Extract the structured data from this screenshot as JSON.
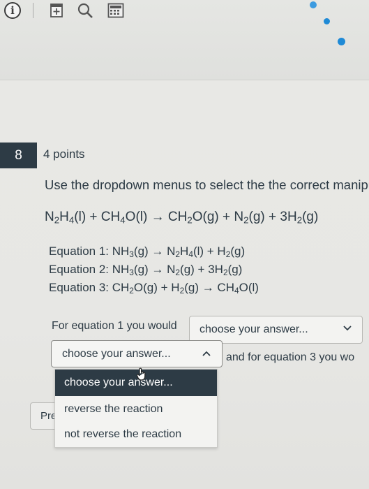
{
  "toolbar": {
    "icons": [
      "info-icon",
      "document-icon",
      "search-icon",
      "calculator-icon"
    ],
    "info_glyph": "i"
  },
  "question": {
    "number": "8",
    "points": "4 points",
    "instruction": "Use the dropdown menus to select the the correct manipu",
    "main_equation": {
      "a": "N",
      "a_sub1": "2",
      "b": "H",
      "b_sub": "4",
      "c": "(l) + CH",
      "c_sub": "4",
      "d": "O(l) → CH",
      "d_sub": "2",
      "e": "O(g) + N",
      "e_sub": "2",
      "f": "(g) + 3H",
      "f_sub": "2",
      "g": "(g)"
    },
    "equations": [
      {
        "label": "Equation 1: NH",
        "p1_sub": "3",
        "p2": "(g) → N",
        "p2_sub": "2",
        "p3": "H",
        "p3_sub": "4",
        "p4": "(l) + H",
        "p4_sub": "2",
        "p5": "(g)"
      },
      {
        "label": "Equation 2: NH",
        "p1_sub": "3",
        "p2": "(g) → N",
        "p2_sub": "2",
        "p3": "(g) + 3H",
        "p3_sub": "2",
        "p4": "(g)"
      },
      {
        "label": "Equation 3: CH",
        "p1_sub": "2",
        "p2": "O(g) + H",
        "p2_sub": "2",
        "p3": "(g) → CH",
        "p3_sub": "4",
        "p4": "O(l)"
      }
    ],
    "prompt1": "For equation 1 you would",
    "select1_value": "choose your answer...",
    "select2_value": "choose your answer...",
    "prompt2": "and for equation 3  you wo",
    "options": [
      "choose your answer...",
      "reverse the reaction",
      "not reverse the reaction"
    ],
    "previous_label": "Pre"
  },
  "colors": {
    "text": "#2d3b45",
    "highlight": "#2d3b45",
    "accent_dot": "#1f8ad6"
  }
}
